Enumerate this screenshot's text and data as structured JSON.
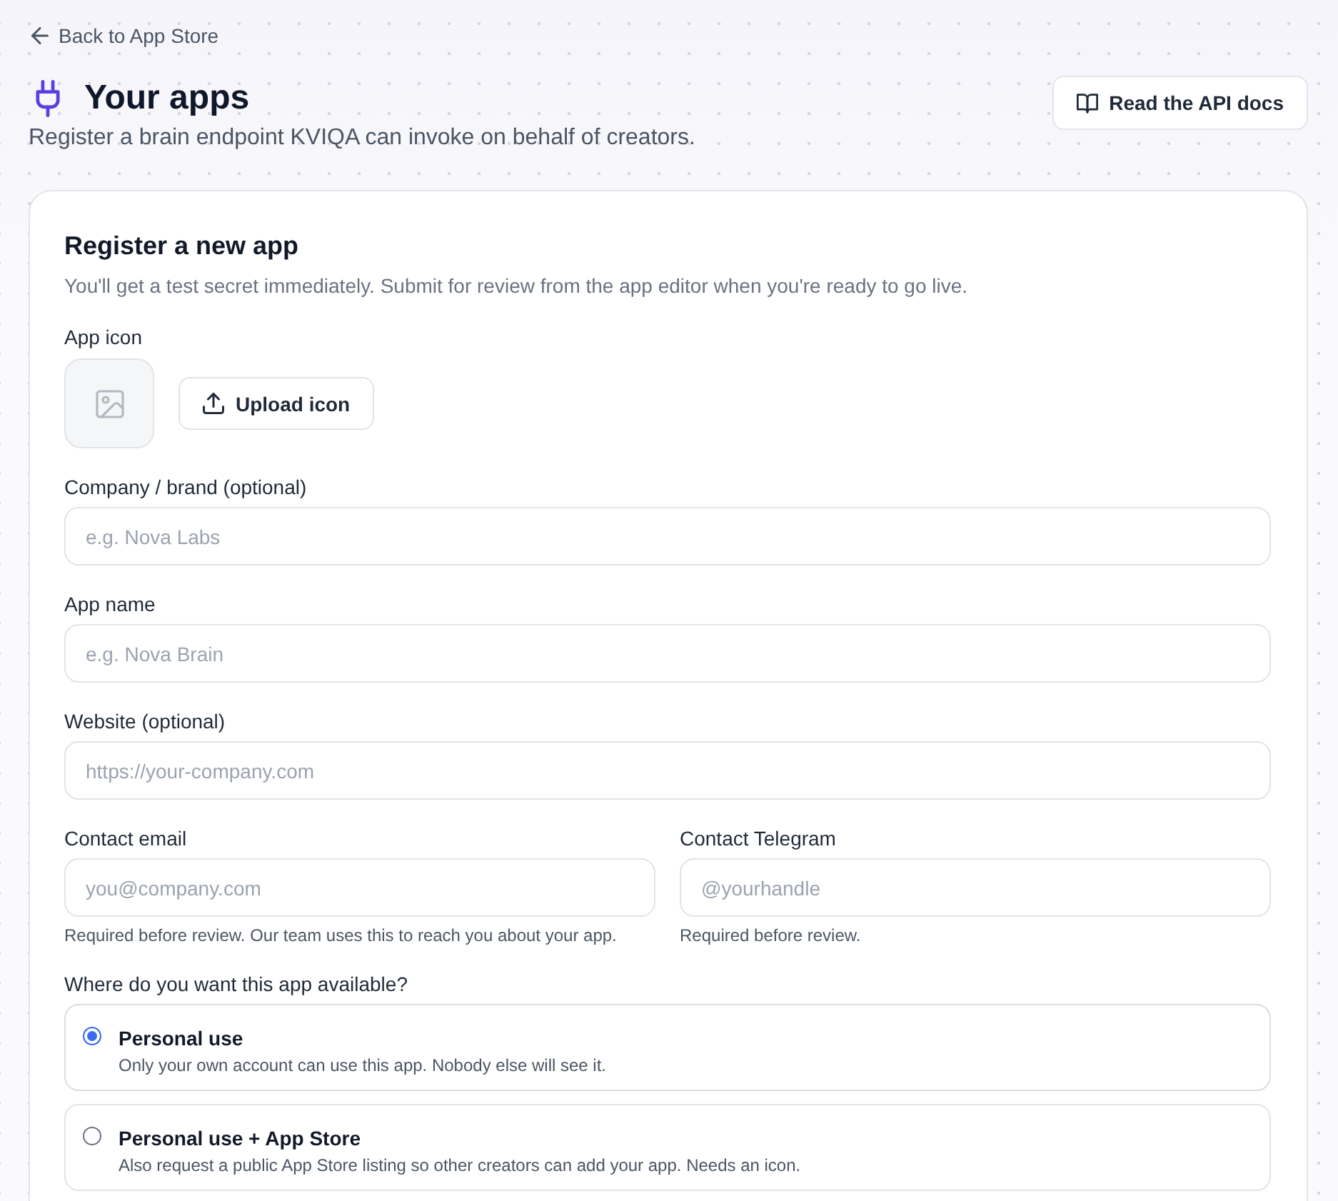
{
  "back_link": {
    "label": "Back to App Store"
  },
  "header": {
    "title": "Your apps",
    "subtitle": "Register a brain endpoint KVIQA can invoke on behalf of creators.",
    "docs_button": "Read the API docs"
  },
  "form": {
    "title": "Register a new app",
    "description": "You'll get a test secret immediately. Submit for review from the app editor when you're ready to go live.",
    "app_icon": {
      "label": "App icon",
      "upload_button": "Upload icon"
    },
    "field_rows": [
      {
        "fields": [
          {
            "label": "Company / brand (optional)",
            "placeholder": "e.g. Nova Labs"
          }
        ]
      },
      {
        "fields": [
          {
            "label": "App name",
            "placeholder": "e.g. Nova Brain"
          }
        ]
      },
      {
        "fields": [
          {
            "label": "Website (optional)",
            "placeholder": "https://your-company.com"
          }
        ]
      },
      {
        "fields": [
          {
            "label": "Contact email",
            "placeholder": "you@company.com",
            "help": "Required before review. Our team uses this to reach you about your app."
          },
          {
            "label": "Contact Telegram",
            "placeholder": "@yourhandle",
            "help": "Required before review."
          }
        ]
      }
    ],
    "availability": {
      "label": "Where do you want this app available?",
      "options": [
        {
          "title": "Personal use",
          "description": "Only your own account can use this app. Nobody else will see it.",
          "selected": true
        },
        {
          "title": "Personal use + App Store",
          "description": "Also request a public App Store listing so other creators can add your app. Needs an icon.",
          "selected": false
        }
      ]
    }
  }
}
